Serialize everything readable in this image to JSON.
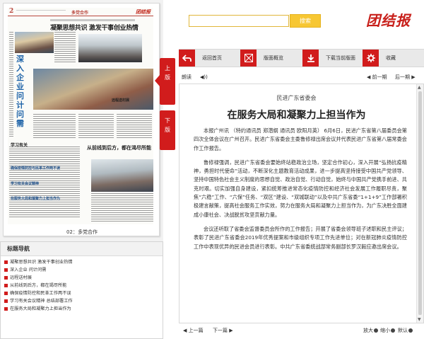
{
  "paper": {
    "page_num": "2",
    "section": "多党合作",
    "logo": "团结报",
    "headline": "凝聚思想共识 激发干事创业热情",
    "left_headline": "深入企业 问计问需",
    "photo_caption": "远程送村展",
    "story_headline": "从前线到后方，都在渴尽所能",
    "small_titles": [
      "学习有关",
      "确保疫情防控与民革工作两不误",
      "学习有关会议精神",
      "在服务大局和凝聚力上担当作为"
    ],
    "caption": "02：多党合作"
  },
  "tabs": {
    "prev": [
      "上",
      "版"
    ],
    "next": [
      "下",
      "版"
    ]
  },
  "nav": {
    "title": "标题导航",
    "items": [
      "凝聚思想共识 激发干事创业热情",
      "深入企业 问计问需",
      "远程送村展",
      "从前线到后方，都在竭尽所能",
      "确保疫情防控和民革工作两不误",
      "学习有关会议精神 总结部署工作",
      "在服务大局和凝聚力上担当作为"
    ]
  },
  "search": {
    "value": "",
    "button": "搜索"
  },
  "brand": "团结报",
  "toolbar": {
    "items": [
      {
        "label": "返回首页",
        "icon": "back-arrow-icon"
      },
      {
        "label": "版面概览",
        "icon": "grid-icon"
      },
      {
        "label": "下载当前版面",
        "icon": "download-icon"
      },
      {
        "label": "收藏",
        "icon": "gear-icon"
      }
    ]
  },
  "reader": {
    "read_label": "朗读",
    "prev_article": "◀ 前一期",
    "next_article": "后一期 ▶"
  },
  "article": {
    "department": "民进广东省委会",
    "title": "在服务大局和凝聚力上担当作为",
    "paragraphs": [
      "本报广州讯 （特约通讯员 郑潜纲 通讯员 欧阳月英） 6月6日，民进广东省第八届委员会第四次全体会议在广州召开。民进广东省委会主委鲁修禄出席会议并代表民进广东省第八届常委会作工作报告。",
      "鲁修禄强调，民进广东省委会要始终站稳政治立场，坚定合作初心，深入开展“弘扬抗疫精神，勇担时代使命”活动，不断深化主题教育活动成果，进一步提高坚持接受中国共产党领导、坚持中国特色社会主义制度的思想自觉、政治自觉、行动自觉，始终与中国共产党携手前进、共克时艰。切实加强自身建设，紧扣统筹推进常态化疫情防控和经济社会发展工作履职尽责，聚焦“六稳”工作、“六保”任务、“双区”建设、“双城联动”以及中共广东省委“1+1+9”工作部署积极建言献策，提高社会服务工作实效，努力在服务大局和凝聚力上担当作为，为广东决胜全面建成小康社会、决战脱贫攻坚贡献力量。",
      "会议还听取了省委会监督委员会所作的工作报告；开展了省委会领导班子述职和民主评议；表彰了民进广东省委会2019年优秀提案和市级组织专项工作先进单位；对在新冠肺炎疫情防控工作中表现优异的民进会员进行表彰。中共广东省委统战部常务副部长罗汉毅应邀出席会议。"
    ]
  },
  "footer": {
    "prev": "上一篇",
    "next": "下一篇",
    "zoom_in": "放大",
    "zoom_out": "缩小",
    "normal": "默认"
  },
  "colors": {
    "accent": "#d11c1c",
    "search_btn": "#f7c733",
    "link_blue": "#1e63a8"
  }
}
